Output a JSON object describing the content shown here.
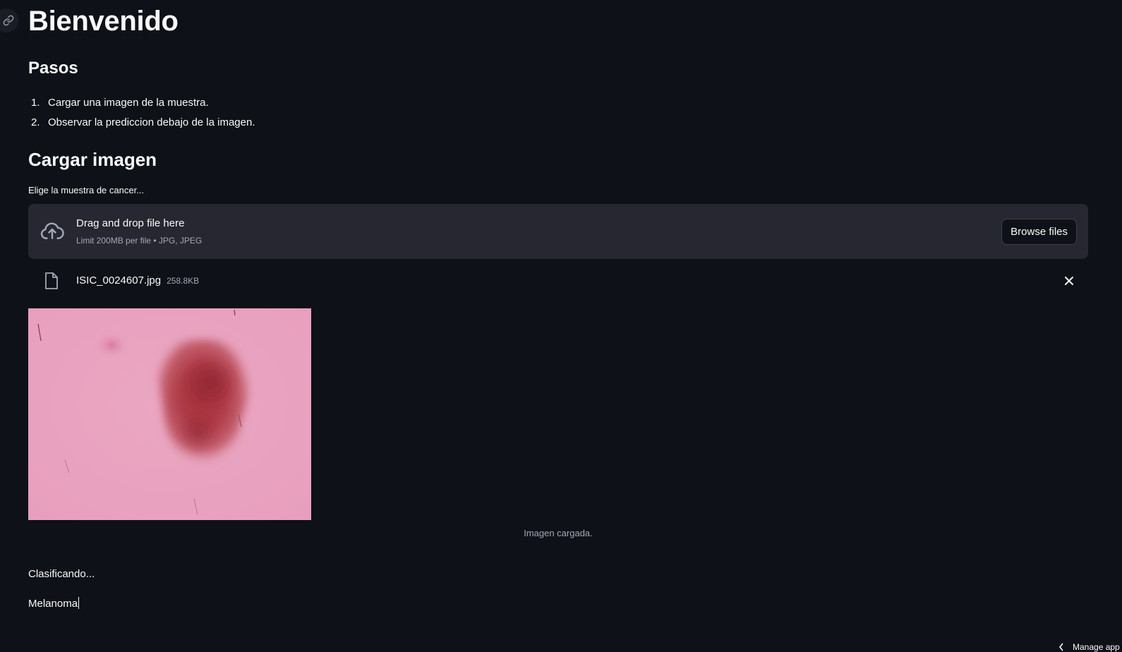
{
  "header": {
    "title": "Bienvenido"
  },
  "steps_section": {
    "heading": "Pasos",
    "items": [
      {
        "number": "1.",
        "text": "Cargar una imagen de la muestra."
      },
      {
        "number": "2.",
        "text": "Observar la prediccion debajo de la imagen."
      }
    ]
  },
  "upload_section": {
    "heading": "Cargar imagen",
    "label": "Elige la muestra de cancer...",
    "dropzone": {
      "primary_text": "Drag and drop file here",
      "secondary_text": "Limit 200MB per file • JPG, JPEG",
      "icon": "cloud-upload-icon"
    },
    "browse_button": "Browse files",
    "uploaded_file": {
      "name": "ISIC_0024607.jpg",
      "size": "258.8KB",
      "icon": "file-icon",
      "remove_icon": "close-icon"
    }
  },
  "image": {
    "caption": "Imagen cargada."
  },
  "result": {
    "status": "Clasificando...",
    "prediction": "Melanoma"
  },
  "footer": {
    "manage_app": "Manage app"
  },
  "colors": {
    "background": "#0e1117",
    "surface": "#262730",
    "text": "#fafafa",
    "muted": "#a3a8b8"
  }
}
